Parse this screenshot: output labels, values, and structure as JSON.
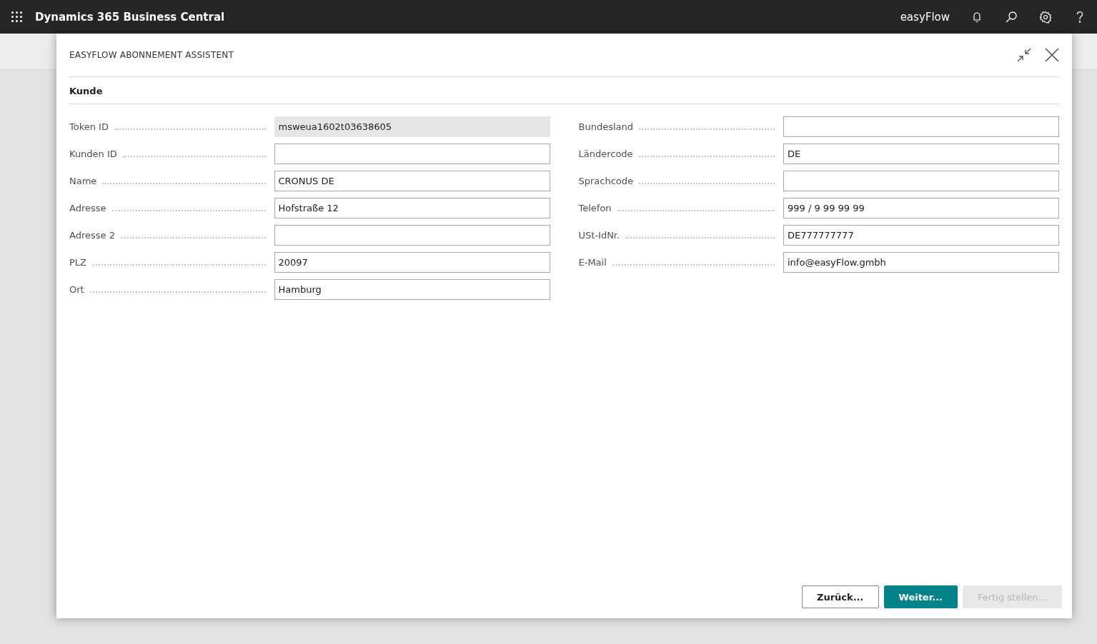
{
  "app_bar": {
    "title": "Dynamics 365 Business Central",
    "company": "easyFlow"
  },
  "dialog": {
    "title": "EASYFLOW ABONNEMENT ASSISTENT",
    "section": "Kunde",
    "columns": [
      [
        {
          "label": "Token ID",
          "value": "msweua1602t03638605",
          "disabled": true
        },
        {
          "label": "Kunden ID",
          "disabled": false
        },
        {
          "label": "Name",
          "value": "CRONUS DE",
          "disabled": false
        },
        {
          "label": "Adresse",
          "value": "Hofstraße 12",
          "disabled": false
        },
        {
          "label": "Adresse 2",
          "disabled": false
        },
        {
          "label": "PLZ",
          "value": "20097",
          "disabled": false
        },
        {
          "label": "Ort",
          "value": "Hamburg",
          "disabled": false
        }
      ],
      [
        {
          "label": "Bundesland",
          "disabled": false
        },
        {
          "label": "Ländercode",
          "value": "DE",
          "disabled": false
        },
        {
          "label": "Sprachcode",
          "disabled": false
        },
        {
          "label": "Telefon",
          "value": "999 / 9 99 99 99",
          "disabled": false
        },
        {
          "label": "USt-IdNr.",
          "value": "DE777777777",
          "disabled": false
        },
        {
          "label": "E-Mail",
          "value": "info@easyFlow.gmbh",
          "disabled": false
        }
      ]
    ],
    "buttons": [
      {
        "label": "Zurück...",
        "kind": "secondary",
        "disabled": false
      },
      {
        "label": "Weiter...",
        "kind": "primary",
        "disabled": false
      },
      {
        "label": "Fertig stellen...",
        "kind": "secondary",
        "disabled": true
      }
    ]
  }
}
